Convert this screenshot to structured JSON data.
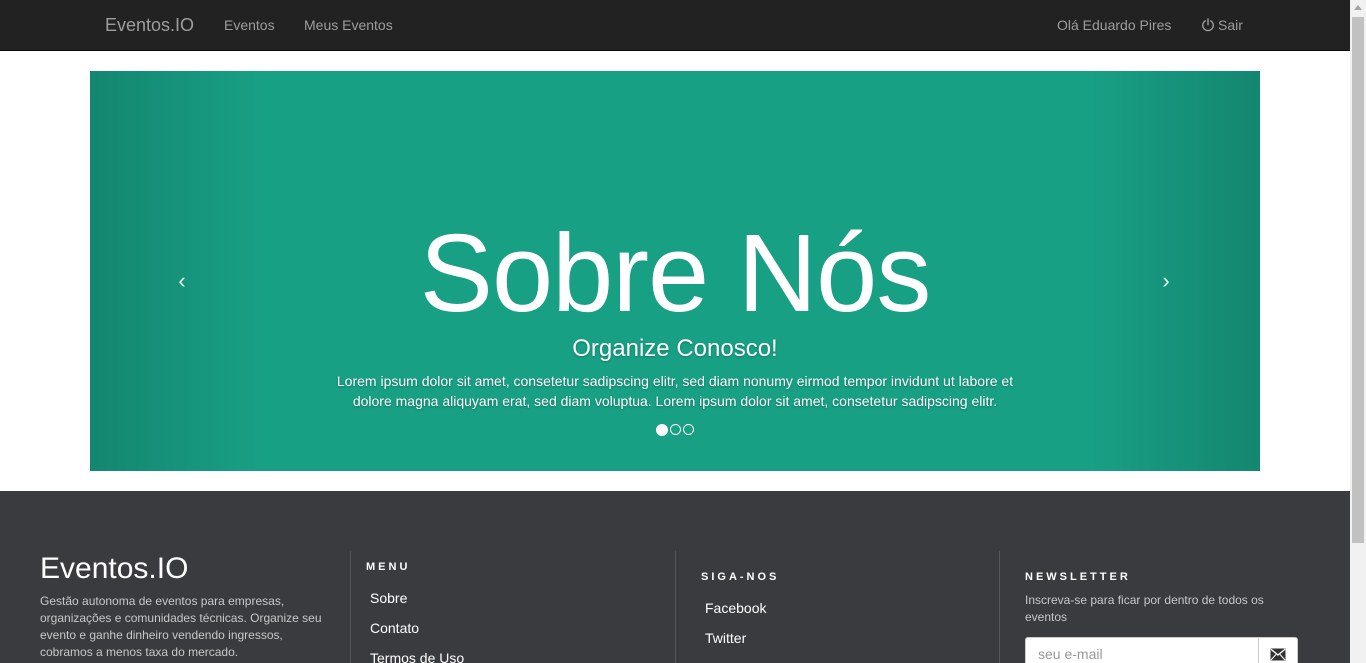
{
  "navbar": {
    "brand": "Eventos.IO",
    "links": [
      "Eventos",
      "Meus Eventos"
    ],
    "user_greeting": "Olá Eduardo Pires",
    "logout_label": "Sair",
    "logout_icon": "power-icon"
  },
  "carousel": {
    "title": "Sobre Nós",
    "subtitle": "Organize Conosco!",
    "text": "Lorem ipsum dolor sit amet, consetetur sadipscing elitr, sed diam nonumy eirmod tempor invidunt ut labore et dolore magna aliquyam erat, sed diam voluptua. Lorem ipsum dolor sit amet, consetetur sadipscing elitr.",
    "prev_icon": "‹",
    "next_icon": "›",
    "slide_count": 3,
    "active_slide": 1,
    "background_color": "#18a085"
  },
  "footer": {
    "brand": "Eventos.IO",
    "description": "Gestão autonoma de eventos para empresas, organizações e comunidades técnicas. Organize seu evento e ganhe dinheiro vendendo ingressos, cobramos a menos taxa do mercado.",
    "menu": {
      "heading": "MENU",
      "items": [
        "Sobre",
        "Contato",
        "Termos de Uso"
      ]
    },
    "social": {
      "heading": "SIGA-NOS",
      "items": [
        "Facebook",
        "Twitter"
      ]
    },
    "newsletter": {
      "heading": "NEWSLETTER",
      "text": "Inscreva-se para ficar por dentro de todos os eventos",
      "placeholder": "seu e-mail",
      "submit_icon": "envelope-icon"
    },
    "background_color": "#3a3b3f"
  }
}
